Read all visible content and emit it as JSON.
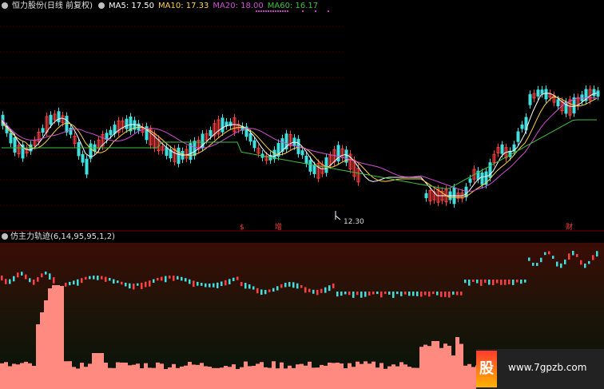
{
  "header": {
    "stock_name": "恒力股份(日线 前复权)",
    "ma5": "MA5: 17.50",
    "ma10": "MA10: 17.33",
    "ma20": "MA20: 18.00",
    "ma60": "MA60: 16.17"
  },
  "price_panel": {
    "low_marker_label": "12.30",
    "events": [
      "$",
      "增",
      "财"
    ]
  },
  "indicator_panel": {
    "title": "仿主力轨迹(6,14,95,95,1,2)"
  },
  "watermark": {
    "logo": "股",
    "url": "www.7gpzb.com"
  },
  "colors": {
    "up": "#ff4040",
    "down": "#40e0e0",
    "ma5": "#ffffff",
    "ma10": "#ffd24d",
    "ma20": "#d050d0",
    "ma60": "#40c040",
    "grid": "#3a0000",
    "volume_bar": "#ff8a80"
  }
}
